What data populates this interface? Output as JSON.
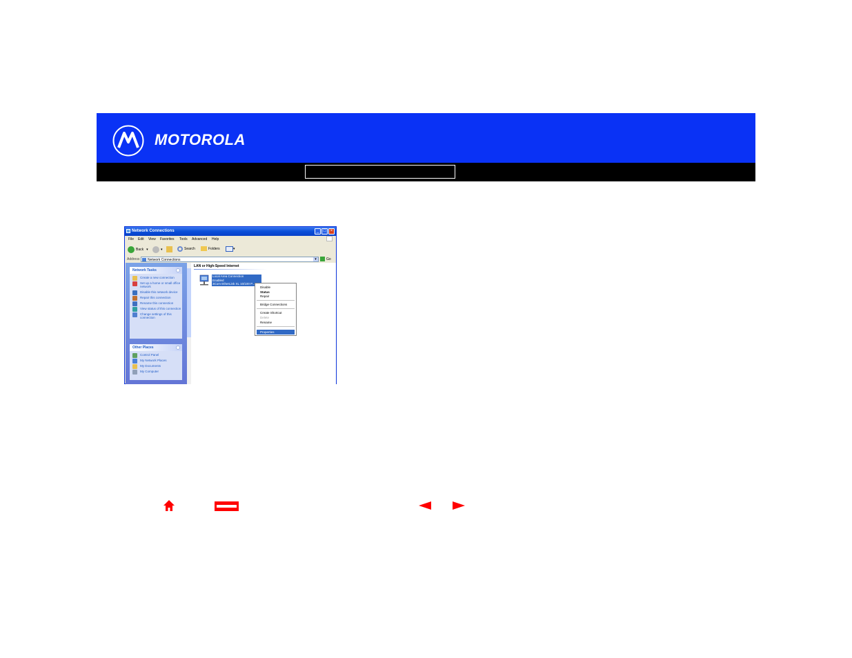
{
  "brand": {
    "name": "MOTOROLA"
  },
  "window": {
    "title": "Network Connections",
    "menu": [
      "File",
      "Edit",
      "View",
      "Favorites",
      "Tools",
      "Advanced",
      "Help"
    ],
    "toolbar": {
      "back": "Back",
      "search": "Search",
      "folders": "Folders"
    },
    "address": {
      "label": "Address",
      "value": "Network Connections",
      "go": "Go"
    },
    "network_tasks": {
      "title": "Network Tasks",
      "items": [
        "Create a new connection",
        "Set up a home or small office network",
        "Disable this network device",
        "Repair this connection",
        "Rename this connection",
        "View status of this connection",
        "Change settings of this connection"
      ]
    },
    "other_places": {
      "title": "Other Places",
      "items": [
        "Control Panel",
        "My Network Places",
        "My Documents",
        "My Computer"
      ]
    },
    "group_title": "LAN or High-Speed Internet",
    "connection": {
      "name": "Local Area Connection",
      "status": "Enabled",
      "device": "3Com EtherLink XL 10/100 P..."
    },
    "context_menu": {
      "disable": "Disable",
      "status": "Status",
      "repair": "Repair",
      "bridge": "Bridge Connections",
      "shortcut": "Create Shortcut",
      "delete": "Delete",
      "rename": "Rename",
      "properties": "Properties"
    }
  },
  "colors": {
    "banner": "#0a32f5",
    "bar": "#000000",
    "nav_icons": "#ff0000",
    "selection": "#316ac5"
  },
  "nav_icons": [
    "home-icon",
    "print-icon",
    "previous-arrow-icon",
    "next-arrow-icon"
  ]
}
